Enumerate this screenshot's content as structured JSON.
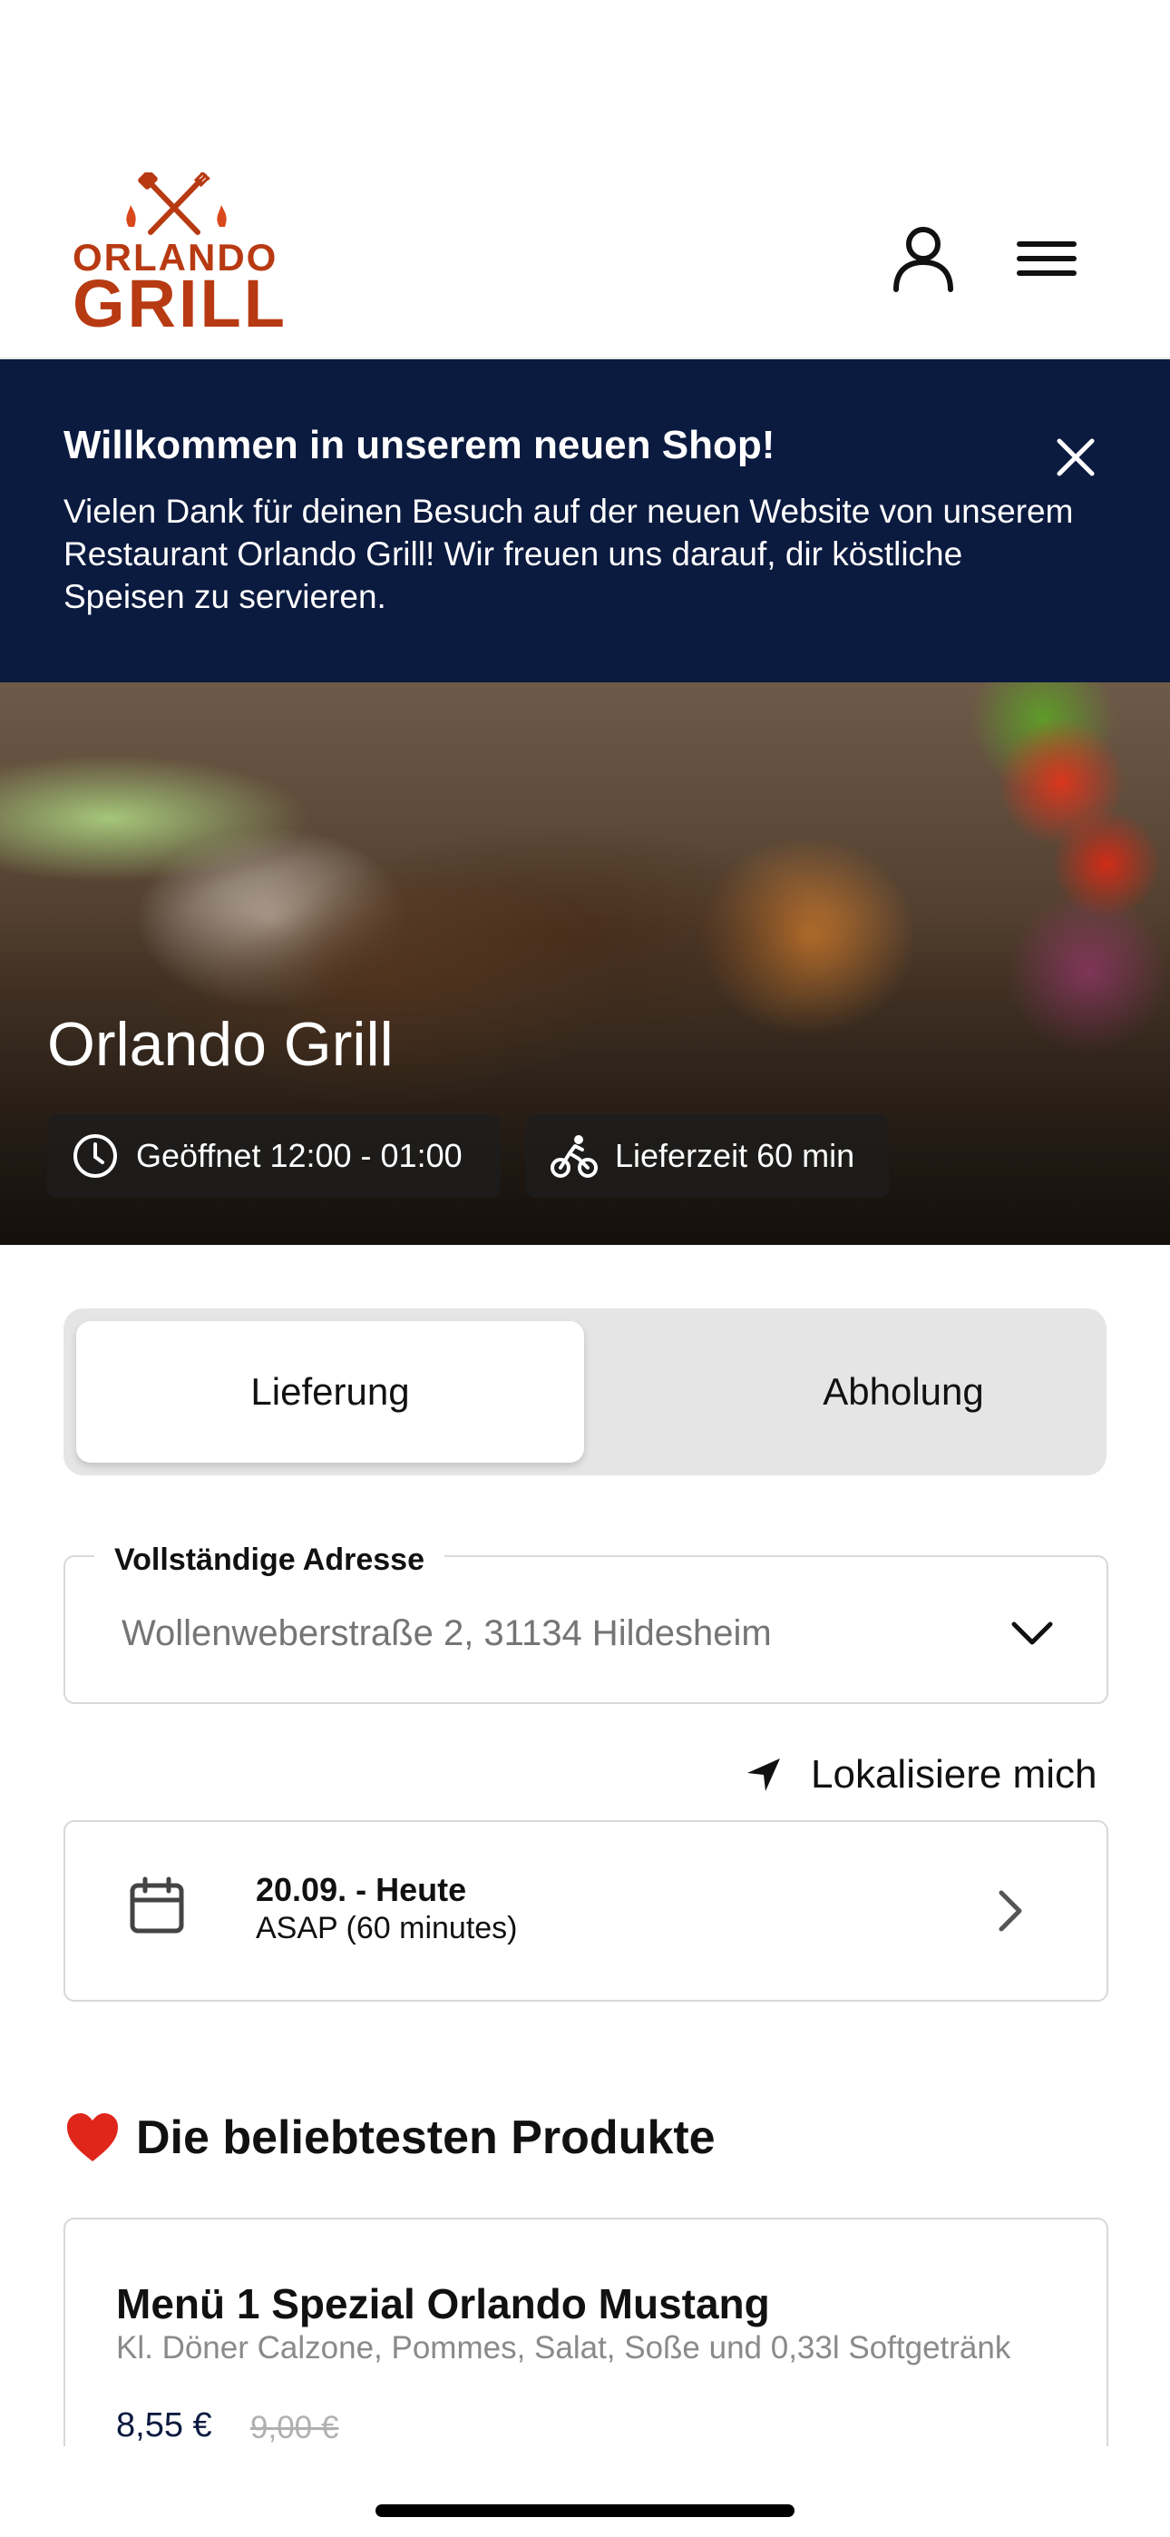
{
  "header": {
    "logo_top": "ORLANDO",
    "logo_bottom": "GRILL",
    "icons": {
      "user": "user-icon",
      "menu": "hamburger-menu-icon"
    }
  },
  "banner": {
    "title": "Willkommen in unserem neuen Shop!",
    "text": "Vielen Dank für deinen Besuch auf der neuen Website von unserem Restaurant Orlando Grill! Wir freuen uns darauf, dir köstliche Speisen zu servieren.",
    "close_icon": "close-icon",
    "bg_color": "#0b1a3f"
  },
  "hero": {
    "title": "Orlando Grill",
    "opening": "Geöffnet 12:00 - 01:00",
    "delivery_time": "Lieferzeit 60 min"
  },
  "order_type": {
    "options": [
      "Lieferung",
      "Abholung"
    ],
    "selected": "Lieferung"
  },
  "address": {
    "label": "Vollständige Adresse",
    "placeholder": "Wollenweberstraße 2, 31134 Hildesheim"
  },
  "locate": {
    "label": "Lokalisiere mich"
  },
  "schedule": {
    "date": "20.09. - Heute",
    "time": "ASAP (60 minutes)"
  },
  "popular": {
    "title": "Die beliebtesten Produkte",
    "products": [
      {
        "name": "Menü 1 Spezial Orlando Mustang",
        "description": "Kl. Döner Calzone, Pommes, Salat, Soße und 0,33l Softgetränk",
        "price": "8,55 €",
        "old_price": "9,00 €"
      }
    ]
  },
  "colors": {
    "brand": "#b83a12",
    "navy": "#0b1a3f"
  }
}
